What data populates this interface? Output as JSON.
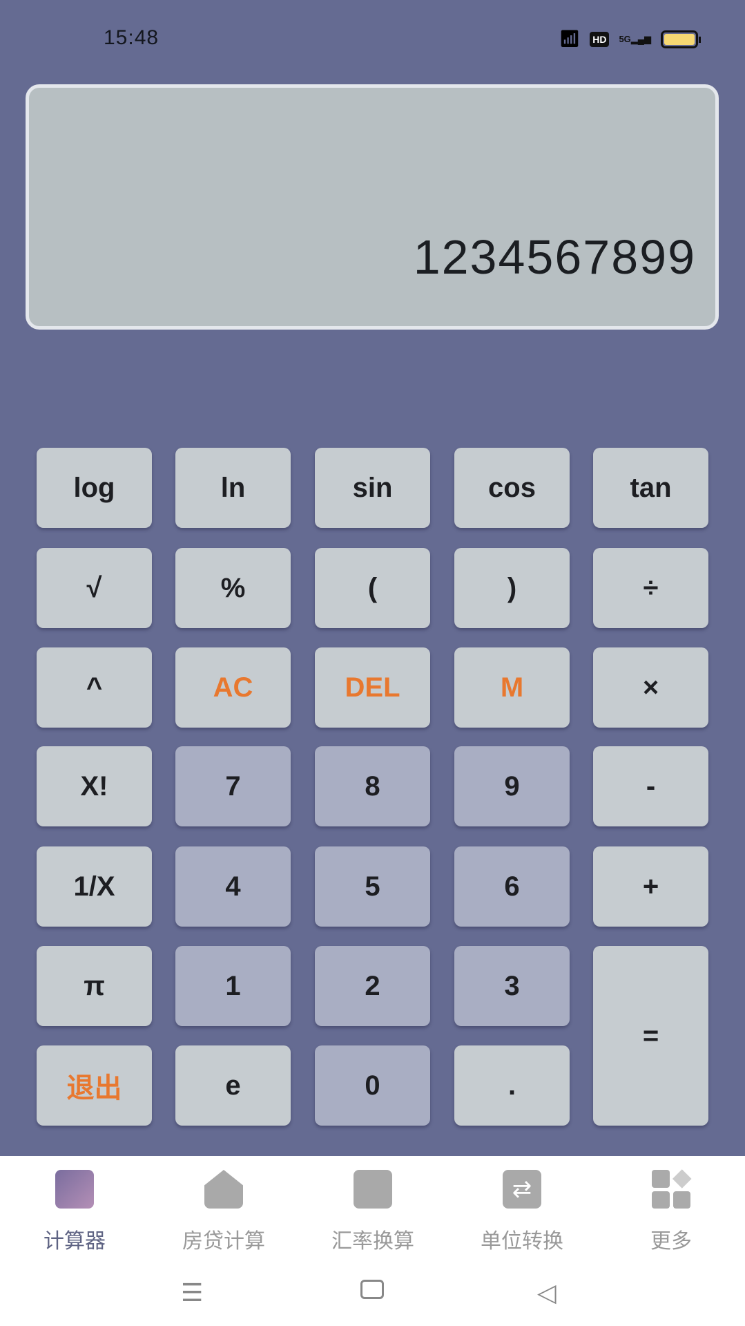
{
  "status": {
    "time": "15:48",
    "hd": "HD",
    "network": "5G"
  },
  "display": {
    "value": "1234567899"
  },
  "keys": [
    [
      "log",
      "ln",
      "sin",
      "cos",
      "tan"
    ],
    [
      "√",
      "%",
      "(",
      ")",
      "÷"
    ],
    [
      "^",
      "AC",
      "DEL",
      "M",
      "×"
    ],
    [
      "X!",
      "7",
      "8",
      "9",
      "-"
    ],
    [
      "1/X",
      "4",
      "5",
      "6",
      "+"
    ],
    [
      "π",
      "1",
      "2",
      "3",
      "="
    ],
    [
      "退出",
      "e",
      "0",
      "."
    ]
  ],
  "nav": {
    "tabs": [
      {
        "label": "计算器",
        "icon": "calculator-icon"
      },
      {
        "label": "房贷计算",
        "icon": "house-yuan-icon"
      },
      {
        "label": "汇率换算",
        "icon": "bar-chart-icon"
      },
      {
        "label": "单位转换",
        "icon": "swap-arrows-icon"
      },
      {
        "label": "更多",
        "icon": "grid-more-icon"
      }
    ],
    "active": 0
  },
  "colors": {
    "background": "#656b92",
    "accent": "#e8782f",
    "key": "#c6ccd0",
    "digit_key": "#a9aec3"
  }
}
